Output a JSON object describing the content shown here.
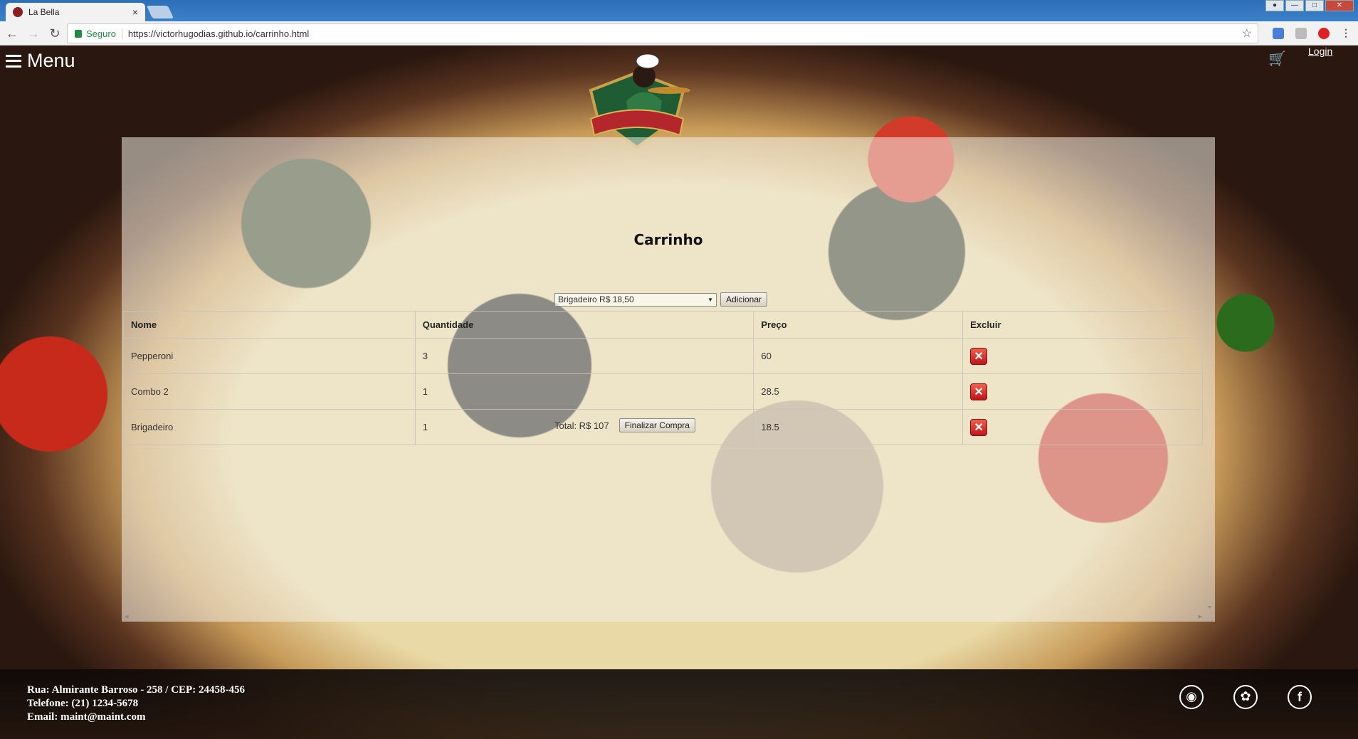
{
  "browser": {
    "tab_title": "La Bella",
    "tab_close": "×",
    "secure_label": "Seguro",
    "url": "https://victorhugodias.github.io/carrinho.html"
  },
  "header": {
    "menu_label": "Menu",
    "login_label": "Login"
  },
  "cart": {
    "title": "Carrinho",
    "product_select_value": "Brigadeiro R$ 18,50",
    "add_button": "Adicionar",
    "columns": [
      "Nome",
      "Quantidade",
      "Preço",
      "Excluir"
    ],
    "rows": [
      {
        "name": "Pepperoni",
        "quantity": "3",
        "price": "60"
      },
      {
        "name": "Combo 2",
        "quantity": "1",
        "price": "28.5"
      },
      {
        "name": "Brigadeiro",
        "quantity": "1",
        "price": "18.5"
      }
    ],
    "total_label": "Total: R$ 107",
    "checkout_button": "Finalizar Compra"
  },
  "footer": {
    "address": "Rua: Almirante Barroso - 258 / CEP: 24458-456",
    "phone": "Telefone: (21) 1234-5678",
    "email": "Email: maint@maint.com"
  },
  "icons": {
    "delete": "x-icon",
    "cart": "shopping-cart-icon",
    "social": [
      "instagram-icon",
      "twitter-icon",
      "facebook-icon"
    ]
  },
  "colors": {
    "delete_red": "#d0201e",
    "secure_green": "#1e8e3e"
  }
}
